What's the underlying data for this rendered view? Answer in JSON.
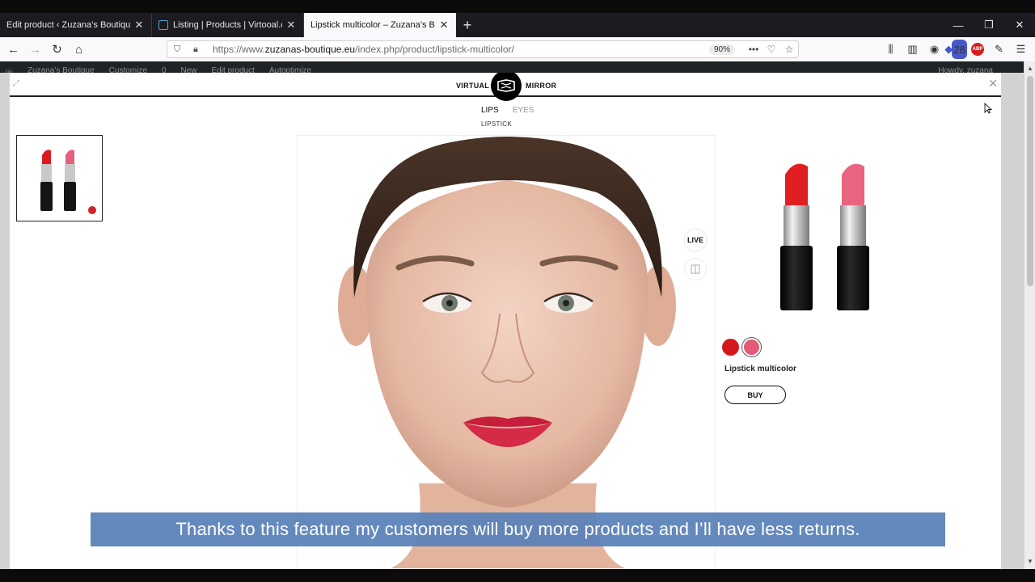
{
  "tabs": [
    {
      "title": "Edit product ‹ Zuzana’s Boutique —",
      "active": false
    },
    {
      "title": "Listing | Products | Virtooal.com",
      "active": false
    },
    {
      "title": "Lipstick multicolor – Zuzana’s Bout",
      "active": true
    }
  ],
  "browser": {
    "url_prefix": "https://www.",
    "url_domain": "zuzanas-boutique.eu",
    "url_path": "/index.php/product/lipstick-multicolor/",
    "zoom": "90%",
    "extension_badge": "28",
    "abp_label": "ABP"
  },
  "wp_admin": {
    "items": [
      "Zuzana’s Boutique",
      "Customize",
      "0",
      "New",
      "Edit product",
      "Autoptimize"
    ],
    "howdy": "Howdy, zuzana"
  },
  "mirror": {
    "left_label": "VIRTUAL",
    "right_label": "MIRROR",
    "tab_lips": "LIPS",
    "tab_eyes": "EYES",
    "subcategory": "LIPSTICK",
    "live_label": "LIVE"
  },
  "product": {
    "name": "Lipstick multicolor",
    "buy_label": "BUY",
    "swatch_colors": [
      "#d4161d",
      "#e45a78"
    ]
  },
  "caption": "Thanks to this feature my customers will buy more products and I’ll have less returns."
}
